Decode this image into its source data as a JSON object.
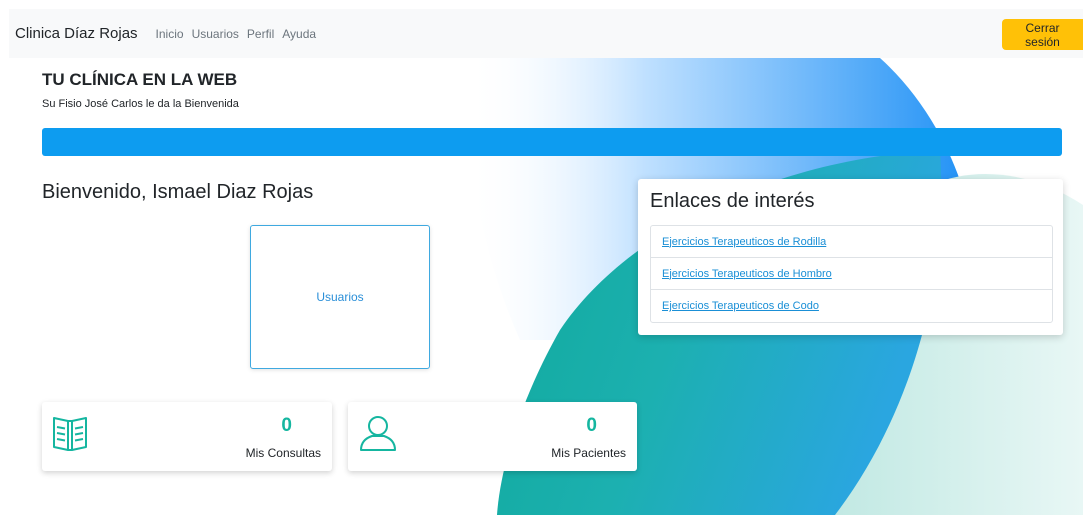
{
  "navbar": {
    "brand": "Clinica Díaz Rojas",
    "links": [
      "Inicio",
      "Usuarios",
      "Perfil",
      "Ayuda"
    ],
    "logout_label": "Cerrar sesión"
  },
  "hero": {
    "title": "TU CLÍNICA EN LA WEB",
    "subtitle": "Su Fisio José Carlos le da la Bienvenida"
  },
  "welcome": "Bienvenido, Ismael Diaz Rojas",
  "users_card": {
    "label": "Usuarios"
  },
  "stats": [
    {
      "value": "0",
      "label": "Mis Consultas",
      "icon": "book-icon"
    },
    {
      "value": "0",
      "label": "Mis Pacientes",
      "icon": "user-icon"
    }
  ],
  "links": {
    "title": "Enlaces de interés",
    "items": [
      "Ejercicios Terapeuticos de Rodilla",
      "Ejercicios Terapeuticos de Hombro",
      "Ejercicios Terapeuticos de Codo"
    ]
  },
  "colors": {
    "accent_blue": "#0d9cf0",
    "teal": "#15b6a0",
    "logout_yellow": "#ffc107"
  }
}
